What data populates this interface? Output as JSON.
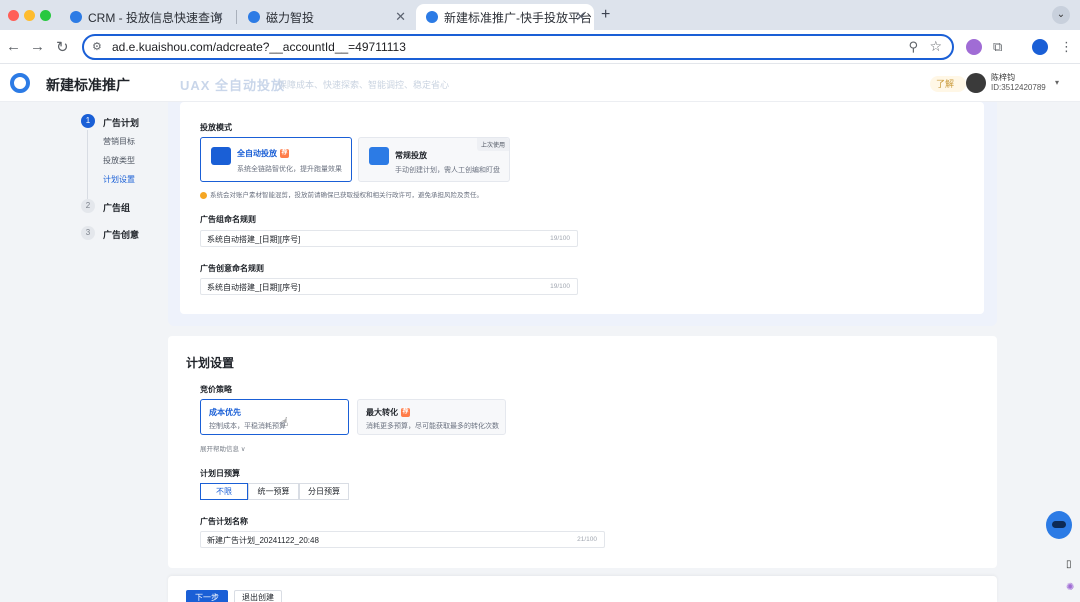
{
  "browser": {
    "tabs": [
      {
        "label": "CRM - 投放信息快速查询"
      },
      {
        "label": "磁力智投"
      },
      {
        "label": "新建标准推广-快手投放平台"
      }
    ],
    "url": "ad.e.kuaishou.com/adcreate?__accountId__=49711113"
  },
  "header": {
    "title": "新建标准推广",
    "banner_brand": "UAX 全自动投放",
    "banner_sub": "保障成本、快速探索、智能调控、稳定省心",
    "badge": "了解",
    "user_name": "陈梓钧",
    "user_id": "ID:3512420789"
  },
  "stepper": {
    "steps": [
      {
        "num": "1",
        "label": "广告计划",
        "subs": [
          "营销目标",
          "投放类型",
          "计划设置"
        ]
      },
      {
        "num": "2",
        "label": "广告组"
      },
      {
        "num": "3",
        "label": "广告创意"
      }
    ]
  },
  "delivery": {
    "mode_label": "投放模式",
    "options": [
      {
        "title": "全自动投放",
        "desc": "系统全链路智优化，提升跑量效果",
        "tag": "荐"
      },
      {
        "title": "常规投放",
        "desc": "手动创建计划，需人工创编和盯盘",
        "badge": "上次使用"
      }
    ],
    "hint": "系统会对账户素材智能混剪，投放前请确保已获取授权和相关行政许可，避免承担风险及责任。",
    "group_rule_label": "广告组命名规则",
    "group_rule_value": "系统自动搭建_[日期][序号]",
    "group_rule_count": "19/100",
    "creative_rule_label": "广告创意命名规则",
    "creative_rule_value": "系统自动搭建_[日期][序号]",
    "creative_rule_count": "19/100"
  },
  "plan": {
    "title": "计划设置",
    "bid_label": "竞价策略",
    "bid_options": [
      {
        "title": "成本优先",
        "desc": "控制成本，平稳消耗预算"
      },
      {
        "title": "最大转化",
        "desc": "消耗更多预算，尽可能获取最多的转化次数",
        "tag": "荐"
      }
    ],
    "expand_text": "展开帮助信息 ∨",
    "budget_label": "计划日预算",
    "budget_options": [
      "不限",
      "统一预算",
      "分日预算"
    ],
    "name_label": "广告计划名称",
    "name_value": "新建广告计划_20241122_20:48",
    "name_count": "21/100"
  },
  "footer": {
    "next": "下一步",
    "exit": "退出创建"
  },
  "colors": {
    "primary": "#1a5fd6",
    "hot_tag": "#ff7d4a"
  }
}
